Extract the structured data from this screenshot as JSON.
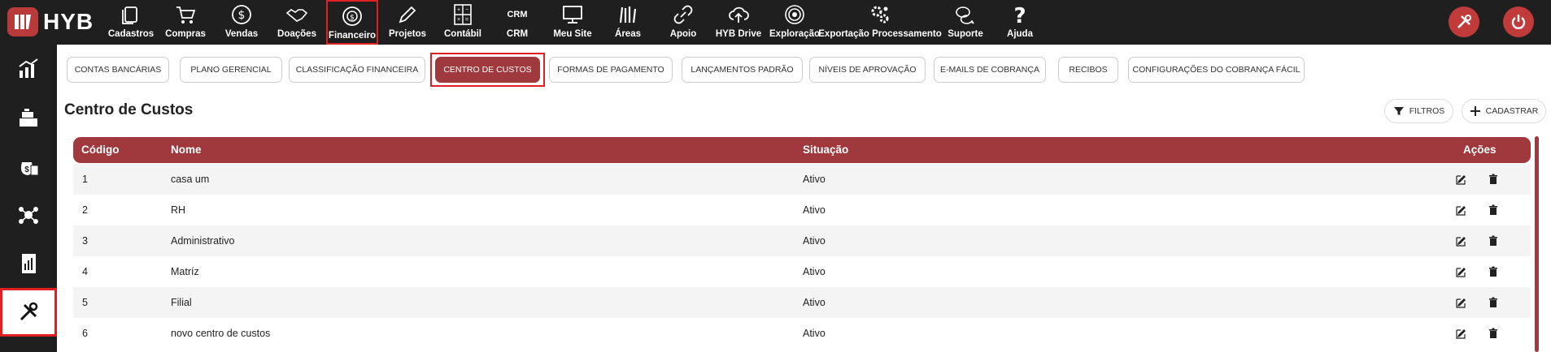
{
  "brand": {
    "name": "HYB"
  },
  "topnav": [
    {
      "id": "cadastros",
      "label": "Cadastros"
    },
    {
      "id": "compras",
      "label": "Compras"
    },
    {
      "id": "vendas",
      "label": "Vendas"
    },
    {
      "id": "doacoes",
      "label": "Doações"
    },
    {
      "id": "financeiro",
      "label": "Financeiro"
    },
    {
      "id": "projetos",
      "label": "Projetos"
    },
    {
      "id": "contabil",
      "label": "Contábil"
    },
    {
      "id": "crm",
      "label": "CRM",
      "icon_text": "CRM"
    },
    {
      "id": "meusite",
      "label": "Meu Site"
    },
    {
      "id": "areas",
      "label": "Áreas"
    },
    {
      "id": "apoio",
      "label": "Apoio"
    },
    {
      "id": "hybdrive",
      "label": "HYB Drive"
    },
    {
      "id": "exploracao",
      "label": "Exploração"
    },
    {
      "id": "exportacao",
      "label": "Exportação Processamento"
    },
    {
      "id": "suporte",
      "label": "Suporte"
    },
    {
      "id": "ajuda",
      "label": "Ajuda"
    }
  ],
  "subtabs": [
    "CONTAS BANCÁRIAS",
    "PLANO GERENCIAL",
    "CLASSIFICAÇÃO FINANCEIRA",
    "CENTRO DE CUSTOS",
    "FORMAS DE PAGAMENTO",
    "LANÇAMENTOS PADRÃO",
    "NÍVEIS DE APROVAÇÃO",
    "E-MAILS DE COBRANÇA",
    "RECIBOS",
    "CONFIGURAÇÕES DO COBRANÇA FÁCIL"
  ],
  "page": {
    "title": "Centro de Custos",
    "filter_label": "FILTROS",
    "add_label": "CADASTRAR"
  },
  "table": {
    "columns": [
      "Código",
      "Nome",
      "Situação",
      "Ações"
    ],
    "rows": [
      {
        "codigo": "1",
        "nome": "casa um",
        "situacao": "Ativo"
      },
      {
        "codigo": "2",
        "nome": "RH",
        "situacao": "Ativo"
      },
      {
        "codigo": "3",
        "nome": "Administrativo",
        "situacao": "Ativo"
      },
      {
        "codigo": "4",
        "nome": "Matríz",
        "situacao": "Ativo"
      },
      {
        "codigo": "5",
        "nome": "Filial",
        "situacao": "Ativo"
      },
      {
        "codigo": "6",
        "nome": "novo centro de custos",
        "situacao": "Ativo"
      }
    ]
  },
  "colors": {
    "topbar": "#1f1f1f",
    "accent": "#a0393d",
    "highlight": "#e02020",
    "power": "#c23b3b"
  }
}
